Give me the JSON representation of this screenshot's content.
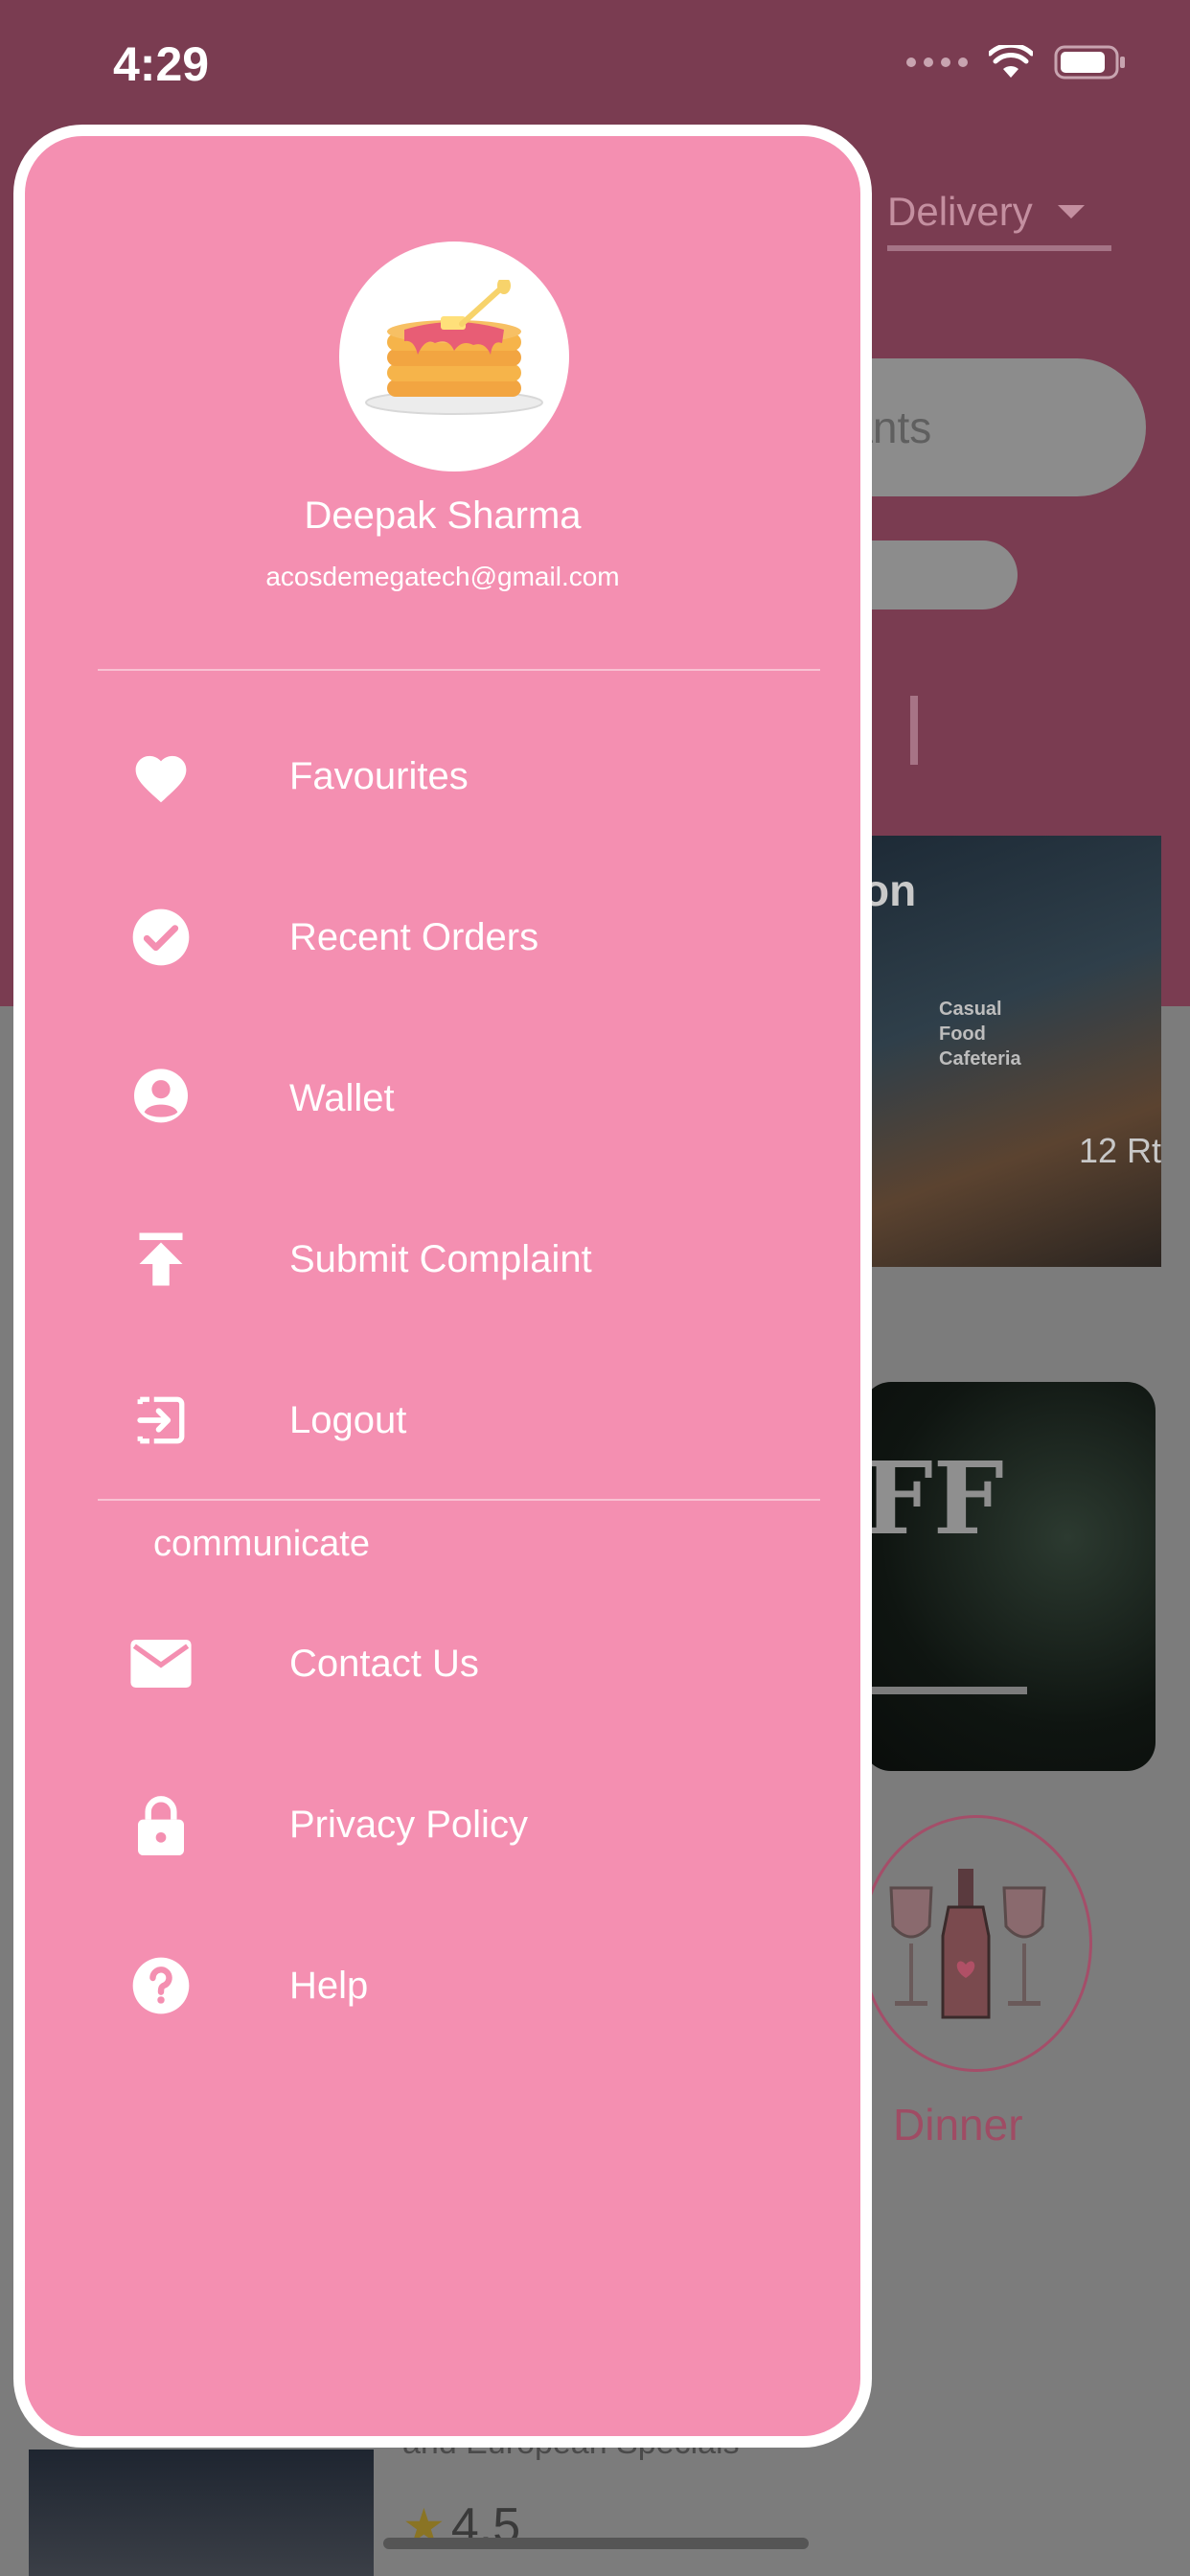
{
  "status_bar": {
    "time": "4:29"
  },
  "background": {
    "delivery_label": "Delivery",
    "search_partial": "rants",
    "card1_title": "on",
    "card1_sign": "Casual\nFood\nCafeteria",
    "card1_count": "12 Rt",
    "card2_text": "FF",
    "category_label": "Dinner",
    "bottom_text": "and European Specials",
    "rating": "4.5"
  },
  "drawer": {
    "user": {
      "name": "Deepak Sharma",
      "email": "acosdemegatech@gmail.com"
    },
    "menu": [
      {
        "label": "Favourites",
        "icon": "heart-icon"
      },
      {
        "label": "Recent Orders",
        "icon": "check-circle-icon"
      },
      {
        "label": "Wallet",
        "icon": "account-circle-icon"
      },
      {
        "label": "Submit Complaint",
        "icon": "upload-icon"
      },
      {
        "label": "Logout",
        "icon": "logout-icon"
      }
    ],
    "section_label": "communicate",
    "communicate": [
      {
        "label": "Contact Us",
        "icon": "mail-icon"
      },
      {
        "label": "Privacy Policy",
        "icon": "lock-icon"
      },
      {
        "label": "Help",
        "icon": "help-icon"
      }
    ]
  },
  "colors": {
    "drawer_bg": "#f48fb1",
    "header_bg": "#7a3c51",
    "accent": "#a44e69"
  }
}
